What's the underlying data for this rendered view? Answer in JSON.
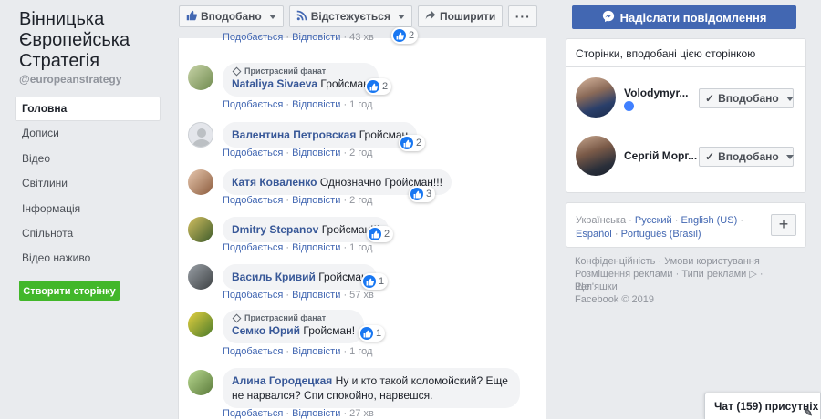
{
  "sidebar": {
    "page_name": "Вінницька Європейська Стратегія",
    "handle": "@europeanstrategy",
    "nav": [
      {
        "label": "Головна"
      },
      {
        "label": "Дописи"
      },
      {
        "label": "Відео"
      },
      {
        "label": "Світлини"
      },
      {
        "label": "Інформація"
      },
      {
        "label": "Спільнота"
      },
      {
        "label": "Відео наживо"
      }
    ],
    "create_page": "Створити сторінку"
  },
  "actions": {
    "liked": "Вподобано",
    "following": "Відстежується",
    "share": "Поширити",
    "more": "···"
  },
  "comment_actions": {
    "like": "Подобається",
    "reply": "Відповісти",
    "sep": "·"
  },
  "comments": [
    {
      "author": "",
      "text": "",
      "reactions": "2",
      "time": "43 хв",
      "fan": false
    },
    {
      "author": "Nataliya Sivaeva",
      "text": "Гройсман",
      "reactions": "2",
      "time": "1 год",
      "fan": true,
      "fan_label": "Пристрасний фанат"
    },
    {
      "author": "Валентина Петровская",
      "text": "Гройсман",
      "reactions": "2",
      "time": "2 год",
      "fan": false
    },
    {
      "author": "Катя Коваленко",
      "text": "Однозначно Гройсман!!!",
      "reactions": "3",
      "time": "2 год",
      "fan": false
    },
    {
      "author": "Dmitry Stepanov",
      "text": "Гройсман!!!",
      "reactions": "2",
      "time": "1 год",
      "fan": false
    },
    {
      "author": "Василь Кривий",
      "text": "Гройсман",
      "reactions": "1",
      "time": "57 хв",
      "fan": false
    },
    {
      "author": "Семко Юрий",
      "text": "Гройсман!",
      "reactions": "1",
      "time": "1 год",
      "fan": true,
      "fan_label": "Пристрасний фанат"
    },
    {
      "author": "Алина Городецкая",
      "text": "Ну и кто такой коломойский? Еще не нарвался? Спи спокойно, нарвешся.",
      "reactions": "",
      "time": "27 хв",
      "fan": false
    }
  ],
  "right": {
    "send_message": "Надіслати повідомлення",
    "liked_title": "Сторінки, вподобані цією сторінкою",
    "liked_pages": [
      {
        "name": "Volodymyr...",
        "button": "Вподобано",
        "verified": true
      },
      {
        "name": "Сергій Морг...",
        "button": "Вподобано",
        "verified": false
      }
    ],
    "languages": {
      "current": "Українська",
      "others": [
        "Русский",
        "English (US)",
        "Español",
        "Português (Brasil)"
      ]
    },
    "footer": {
      "line1": [
        "Конфіденційність",
        "Умови користування"
      ],
      "line2": [
        "Розміщення реклами",
        "Типи реклами ▷",
        "Реп'яшки"
      ],
      "line3": "Ще",
      "copyright": "Facebook © 2019"
    },
    "chat": "Чат (159) присутніх"
  },
  "colors": {
    "link": "#385898",
    "brand": "#4267b2",
    "green": "#42b72a",
    "like": "#1877f2"
  }
}
